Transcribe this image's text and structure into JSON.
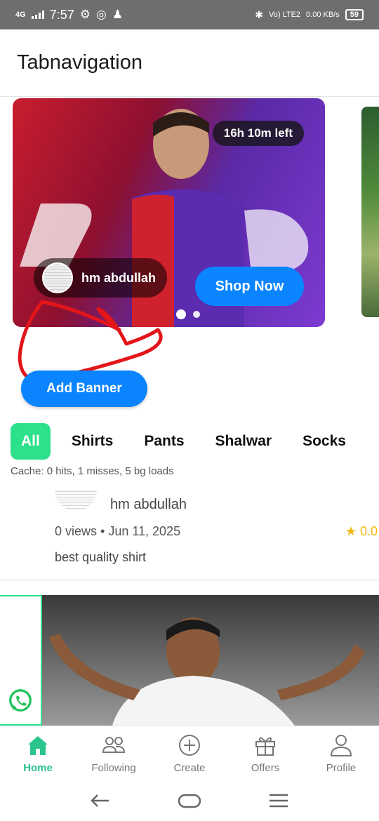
{
  "status_bar": {
    "network": "4G",
    "time": "7:57",
    "volte": "Vo) LTE2",
    "speed": "0.00 KB/s",
    "battery": "59"
  },
  "app_bar": {
    "title": "Tabnavigation"
  },
  "banner": {
    "time_left": "16h 10m left",
    "author": "hm abdullah",
    "cta_label": "Shop Now",
    "pagination": {
      "count": 2,
      "active_index": 0
    }
  },
  "add_banner_label": "Add Banner",
  "tabs": [
    {
      "label": "All",
      "active": true
    },
    {
      "label": "Shirts",
      "active": false
    },
    {
      "label": "Pants",
      "active": false
    },
    {
      "label": "Shalwar",
      "active": false
    },
    {
      "label": "Socks",
      "active": false
    }
  ],
  "cache_text": "Cache: 0 hits, 1 misses, 5 bg loads",
  "post": {
    "author": "hm abdullah",
    "meta": "0 views • Jun 11, 2025",
    "rating": "★ 0.0",
    "description": "best quality shirt"
  },
  "bottom_nav": [
    {
      "label": "Home",
      "icon": "home-icon",
      "active": true
    },
    {
      "label": "Following",
      "icon": "people-icon",
      "active": false
    },
    {
      "label": "Create",
      "icon": "plus-circle-icon",
      "active": false
    },
    {
      "label": "Offers",
      "icon": "gift-icon",
      "active": false
    },
    {
      "label": "Profile",
      "icon": "person-icon",
      "active": false
    }
  ],
  "colors": {
    "accent_green": "#2de08b",
    "primary_blue": "#0a84ff",
    "rating_yellow": "#f1b90b",
    "status_bar": "#6e6e6e"
  }
}
